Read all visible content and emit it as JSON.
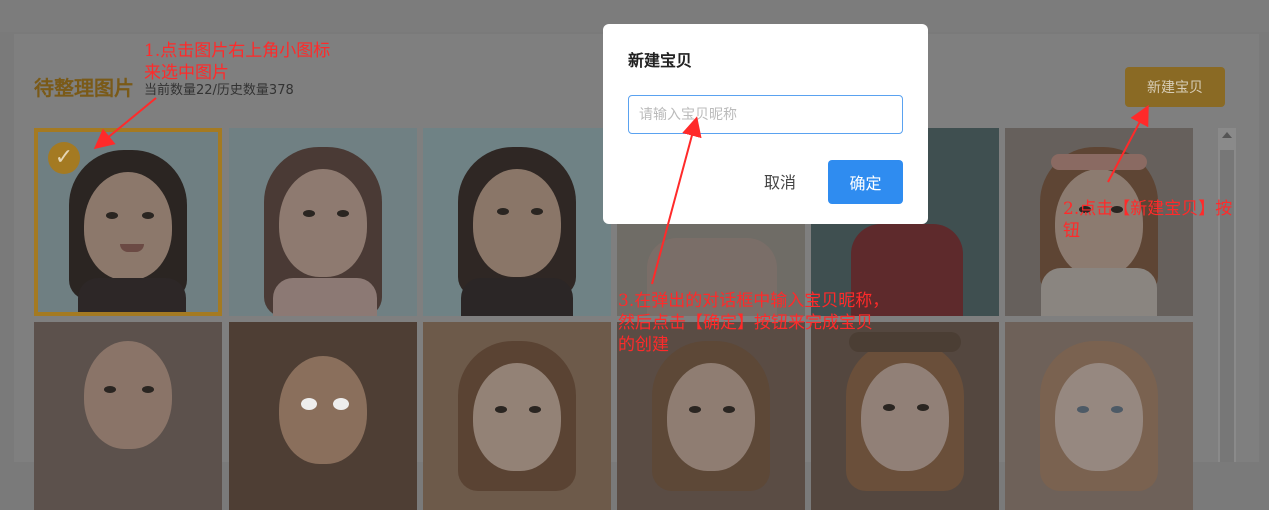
{
  "page": {
    "title": "待整理图片",
    "counts": "当前数量22/历史数量378",
    "new_baby_button": "新建宝贝"
  },
  "icons": {
    "selected_check": "check-icon",
    "scroll_up": "caret-up-icon"
  },
  "photos": [
    {
      "label": "photo-1",
      "selected": true
    },
    {
      "label": "photo-2",
      "selected": false
    },
    {
      "label": "photo-3",
      "selected": false
    },
    {
      "label": "photo-4",
      "selected": false
    },
    {
      "label": "photo-5",
      "selected": false
    },
    {
      "label": "photo-6",
      "selected": false
    },
    {
      "label": "photo-7",
      "selected": false
    },
    {
      "label": "photo-8",
      "selected": false
    },
    {
      "label": "photo-9",
      "selected": false
    },
    {
      "label": "photo-10",
      "selected": false
    },
    {
      "label": "photo-11",
      "selected": false
    },
    {
      "label": "photo-12",
      "selected": false
    }
  ],
  "modal": {
    "title": "新建宝贝",
    "input_placeholder": "请输入宝贝昵称",
    "input_value": "",
    "cancel": "取消",
    "confirm": "确定"
  },
  "annotations": {
    "step1_line1": "1.点击图片右上角小图标",
    "step1_line2": "来选中图片",
    "step2_line1": "2.点击【新建宝贝】按",
    "step2_line2": "钮",
    "step3_line1": "3.在弹出的对话框中输入宝贝昵称，",
    "step3_line2": "然后点击【确定】按钮来完成宝贝",
    "step3_line3": "的创建"
  },
  "colors": {
    "overlay": "#7f7f7f",
    "accent_gold": "#a47a22",
    "primary_blue": "#2f8cf0",
    "annotation_red": "#ff2a2a"
  }
}
